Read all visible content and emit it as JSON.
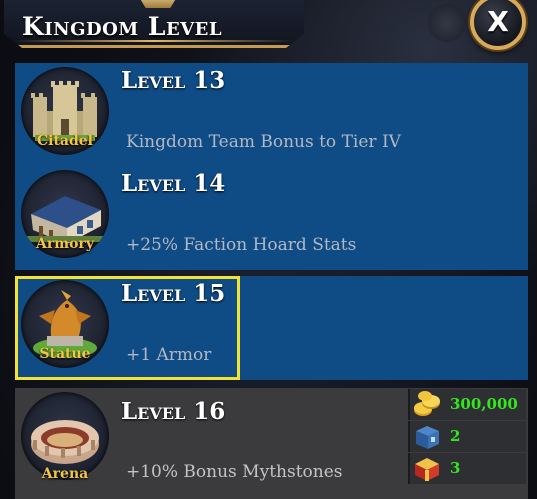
{
  "header": {
    "title": "Kingdom Level",
    "close_label": "X"
  },
  "rows": [
    {
      "building": "Citadel",
      "level": "Level 13",
      "bonus": "Kingdom Team Bonus to Tier IV",
      "state": "unlocked"
    },
    {
      "building": "Armory",
      "level": "Level 14",
      "bonus": "+25% Faction Hoard Stats",
      "state": "unlocked"
    },
    {
      "building": "Statue",
      "level": "Level 15",
      "bonus": "+1 Armor",
      "state": "selected"
    },
    {
      "building": "Arena",
      "level": "Level 16",
      "bonus": "+10% Bonus Mythstones",
      "state": "locked",
      "costs": [
        {
          "icon": "gold-coins-icon",
          "value": "300,000"
        },
        {
          "icon": "blue-crate-icon",
          "value": "2"
        },
        {
          "icon": "red-chest-icon",
          "value": "3"
        }
      ]
    }
  ],
  "colors": {
    "row_blue": "#0f4b84",
    "row_locked": "#3b3b3d",
    "selected_border": "#f2e233",
    "label_gold": "#f2c544",
    "cost_green": "#35e51f"
  }
}
